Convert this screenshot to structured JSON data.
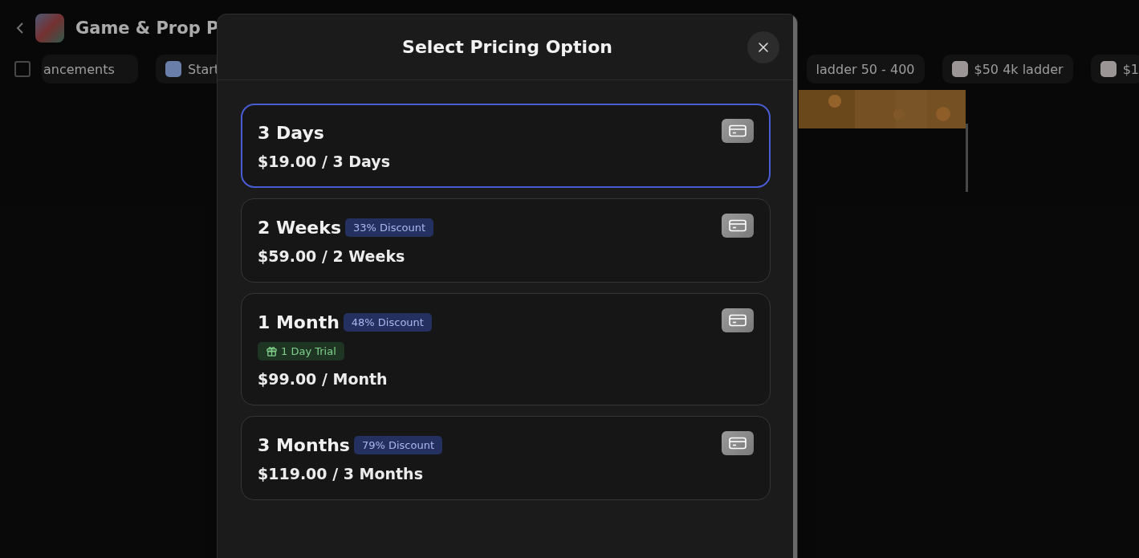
{
  "background": {
    "title": "Game & Prop P",
    "left_chips": [
      {
        "label": "ancements",
        "icon": false
      },
      {
        "label": "Start",
        "icon": true
      }
    ],
    "right_chips": [
      {
        "label": "ladder 50 - 400",
        "icon": false
      },
      {
        "label": "$50 4k ladder",
        "icon": true
      },
      {
        "label": "$1",
        "icon": true
      }
    ]
  },
  "modal": {
    "title": "Select Pricing Option",
    "options": [
      {
        "name": "3 Days",
        "price": "$19.00 / 3 Days",
        "selected": true
      },
      {
        "name": "2 Weeks",
        "discount": "33% Discount",
        "price": "$59.00 / 2 Weeks",
        "selected": false
      },
      {
        "name": "1 Month",
        "discount": "48% Discount",
        "trial": "1 Day Trial",
        "price": "$99.00 / Month",
        "selected": false
      },
      {
        "name": "3 Months",
        "discount": "79% Discount",
        "price": "$119.00 / 3 Months",
        "selected": false
      }
    ]
  }
}
